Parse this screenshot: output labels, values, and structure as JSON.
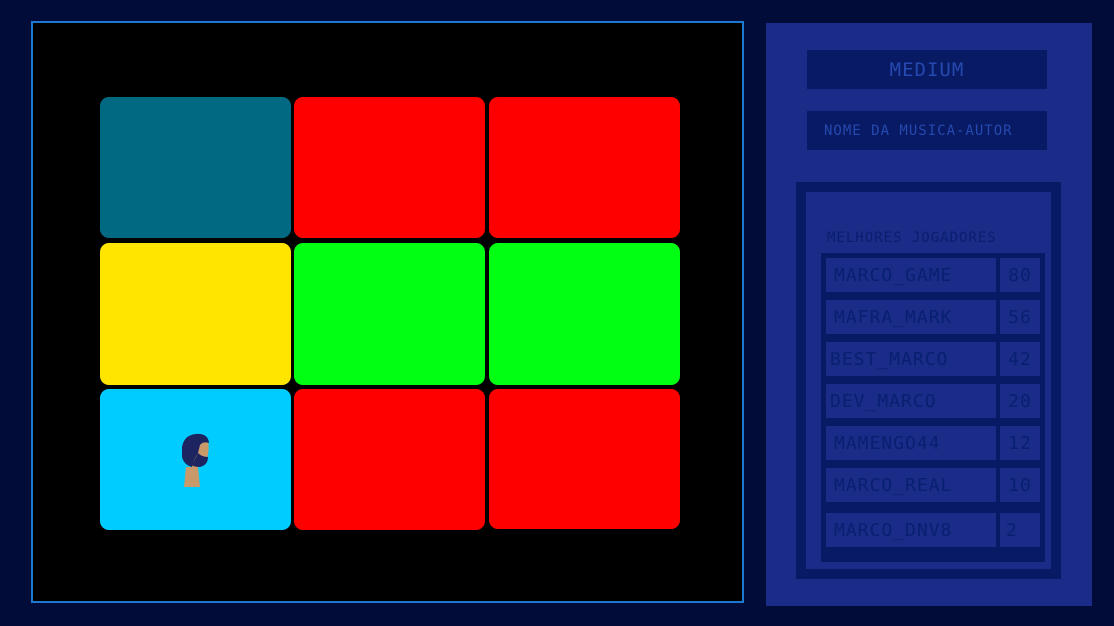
{
  "game": {
    "tiles": [
      {
        "color": "#026983"
      },
      {
        "color": "#ff0000"
      },
      {
        "color": "#ff0000"
      },
      {
        "color": "#ffe500"
      },
      {
        "color": "#00ff12"
      },
      {
        "color": "#00ff12"
      },
      {
        "color": "#00ccff"
      },
      {
        "color": "#ff0000"
      },
      {
        "color": "#ff0000"
      }
    ],
    "player_icon": "bearded-man-avatar-icon"
  },
  "panel": {
    "difficulty": "MEDIUM",
    "song": "NOME DA MUSICA-AUTOR",
    "leaderboard_title": "MELHORES JOGADORES",
    "players": [
      {
        "name": "MARCO_GAME",
        "score": "80"
      },
      {
        "name": "MAFRA_MARK",
        "score": "56"
      },
      {
        "name": "BEST_MARCO",
        "score": "42"
      },
      {
        "name": "DEV_MARCO",
        "score": "20"
      },
      {
        "name": "MAMENGO44",
        "score": "12"
      },
      {
        "name": "MARCO_REAL",
        "score": "10"
      },
      {
        "name": "MARCO_DNV8",
        "score": "2"
      }
    ]
  }
}
